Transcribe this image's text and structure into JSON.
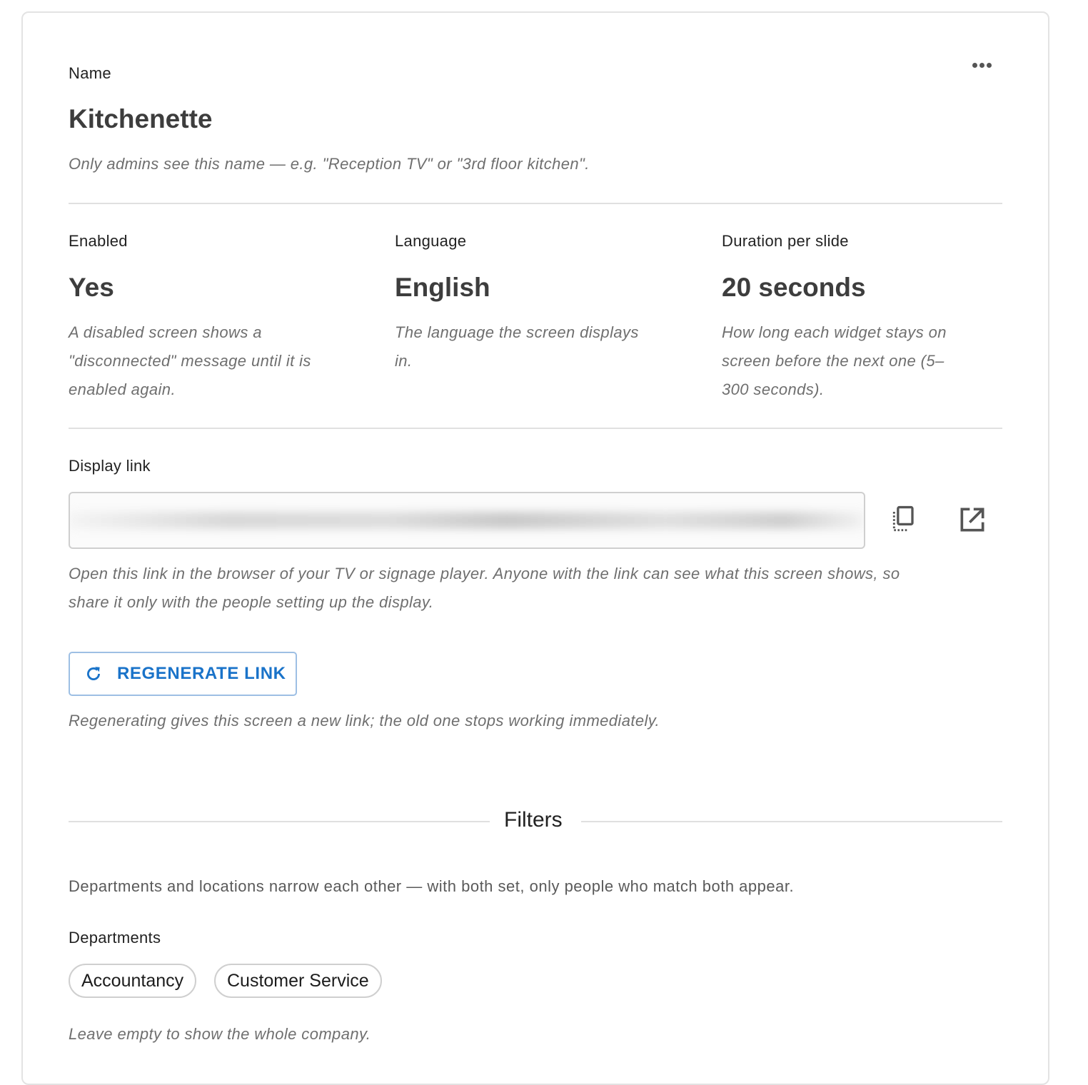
{
  "name_section": {
    "label": "Name",
    "value": "Kitchenette",
    "help": "Only admins see this name — e.g. \"Reception TV\" or \"3rd floor kitchen\"."
  },
  "more_menu": {
    "icon": "more-horizontal-icon"
  },
  "settings": {
    "enabled": {
      "label": "Enabled",
      "value": "Yes",
      "help_lines": [
        "A disabled screen shows a",
        "\"disconnected\" message until it is",
        "enabled again."
      ]
    },
    "language": {
      "label": "Language",
      "value": "English",
      "help_lines": [
        "The language the screen displays",
        "in."
      ]
    },
    "duration": {
      "label": "Duration per slide",
      "value": "20 seconds",
      "help_lines": [
        "How long each widget stays on",
        "screen before the next one (5–",
        "300 seconds)."
      ]
    }
  },
  "display_link": {
    "label": "Display link",
    "value_hidden": true,
    "copy_icon": "copy-icon",
    "open_icon": "open-in-new-icon",
    "help_lines": [
      "Open this link in the browser of your TV or signage player. Anyone with the link can see what this screen shows, so",
      "share it only with the people setting up the display."
    ],
    "regenerate_label": "REGENERATE LINK",
    "regenerate_icon": "refresh-icon",
    "regenerate_help": "Regenerating gives this screen a new link; the old one stops working immediately."
  },
  "filters": {
    "title": "Filters",
    "description": "Departments and locations narrow each other — with both set, only people who match both appear.",
    "departments": {
      "label": "Departments",
      "chips": [
        "Accountancy",
        "Customer Service"
      ],
      "help": "Leave empty to show the whole company."
    }
  },
  "colors": {
    "accent": "#1a73c9",
    "border": "#e3e3e3",
    "help_text": "#6f6f6f"
  }
}
